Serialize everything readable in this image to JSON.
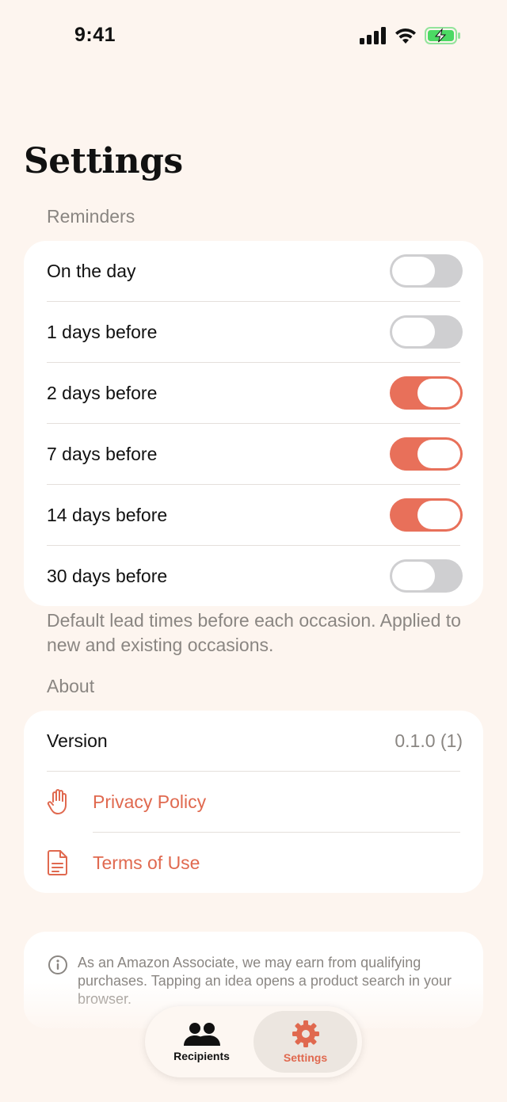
{
  "status_bar": {
    "time": "9:41",
    "icons": [
      "cellular-signal-icon",
      "wifi-icon",
      "battery-charging-icon"
    ]
  },
  "page": {
    "title": "Settings"
  },
  "reminders": {
    "header": "Reminders",
    "items": [
      {
        "label": "On the day",
        "enabled": false
      },
      {
        "label": "1 days before",
        "enabled": false
      },
      {
        "label": "2 days before",
        "enabled": true
      },
      {
        "label": "7 days before",
        "enabled": true
      },
      {
        "label": "14 days before",
        "enabled": true
      },
      {
        "label": "30 days before",
        "enabled": false
      }
    ],
    "footnote": "Default lead times before each occasion. Applied to new and existing occasions."
  },
  "about": {
    "header": "About",
    "version_label": "Version",
    "version_value": "0.1.0 (1)",
    "privacy_label": "Privacy Policy",
    "terms_label": "Terms of Use"
  },
  "disclaimer": {
    "text": "As an Amazon Associate, we may earn from qualifying purchases. Tapping an idea opens a product search in your browser."
  },
  "tab_bar": {
    "tabs": [
      {
        "label": "Recipients",
        "icon": "people-icon",
        "active": false
      },
      {
        "label": "Settings",
        "icon": "gear-icon",
        "active": true
      }
    ]
  },
  "colors": {
    "background": "#fdf5ef",
    "accent": "#e8705a",
    "toggle_off": "#cfcfd1",
    "secondary_text": "#8a8682",
    "battery_green": "#4cd964"
  }
}
